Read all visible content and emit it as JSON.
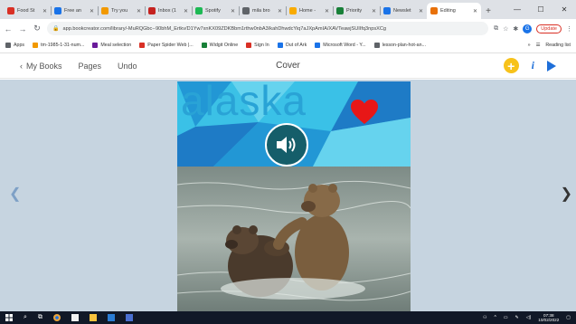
{
  "browser": {
    "tabs": [
      {
        "label": "Food St",
        "color": "#d93025"
      },
      {
        "label": "Free an",
        "color": "#1a73e8"
      },
      {
        "label": "Try you",
        "color": "#f29900"
      },
      {
        "label": "Inbox (1",
        "color": "#c5221f"
      },
      {
        "label": "Spotify",
        "color": "#1db954"
      },
      {
        "label": "mila bro",
        "color": "#5f6368"
      },
      {
        "label": "Home -",
        "color": "#f9ab00"
      },
      {
        "label": "Priority",
        "color": "#188038"
      },
      {
        "label": "Newslet",
        "color": "#1a73e8"
      },
      {
        "label": "Editing",
        "color": "#e8710a"
      }
    ],
    "newtab_label": "+",
    "window_controls": [
      "—",
      "☐",
      "✕"
    ],
    "url": "app.bookcreator.com/library/-MuRQGbc--90bhM_Ertkv/D1Yw7xnKX09ZDKBbm1rthw0nbA3/kahDhwdcYiq7aJXpAmIA/XAVTeawjSUIIfq3npsXCg",
    "update_label": "Update",
    "profile_initial": "G"
  },
  "bookmarks": {
    "items": [
      {
        "label": "Apps",
        "color": "#5f6368"
      },
      {
        "label": "tm-1985-1-31-num...",
        "color": "#f29900"
      },
      {
        "label": "Meal selection",
        "color": "#6a1b9a"
      },
      {
        "label": "Paper Spider Web |...",
        "color": "#d93025"
      },
      {
        "label": "Widgit Online",
        "color": "#188038"
      },
      {
        "label": "Sign In",
        "color": "#d93025"
      },
      {
        "label": "Out of Ark",
        "color": "#1a73e8"
      },
      {
        "label": "Microsoft Word - Y...",
        "color": "#1a73e8"
      },
      {
        "label": "lesson-plan-hot-an...",
        "color": "#5f6368"
      }
    ],
    "more": "»",
    "reading_list": "Reading list"
  },
  "app": {
    "back_label": "My Books",
    "pages_label": "Pages",
    "undo_label": "Undo",
    "title": "Cover",
    "add_label": "+",
    "info_label": "i"
  },
  "book": {
    "banner_text": "alaska",
    "banner_colors": [
      "#3bc1e6",
      "#1e8fd1",
      "#6fd6ee",
      "#1a6fbf"
    ],
    "heart_color": "#e81717",
    "sound_button_color": "#155e6a"
  },
  "taskbar": {
    "time": "07:38",
    "date": "10/02/2022"
  }
}
